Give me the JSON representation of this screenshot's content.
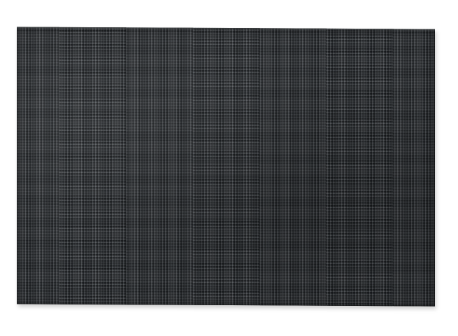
{
  "image": {
    "subject": "placemat",
    "colors": {
      "background": "#ffffff",
      "mat": "#2a2d30",
      "weave_highlight": "#bec3c8"
    }
  }
}
